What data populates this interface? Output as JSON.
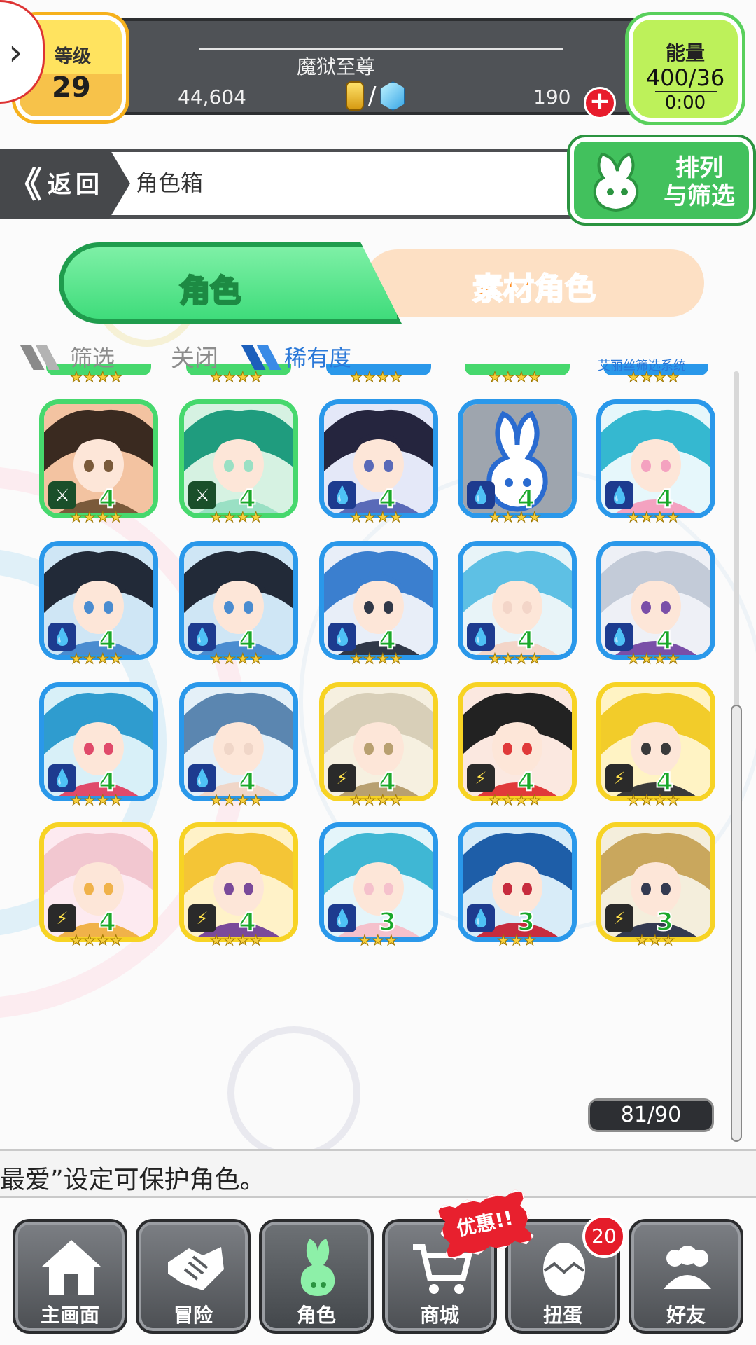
{
  "status": {
    "level_label": "等级",
    "level": "29",
    "rank_title": "魔狱至尊",
    "gold": "44,604",
    "currency_separator": "/",
    "gems": "190",
    "add_symbol": "+",
    "energy_label": "能量",
    "energy": "400/36",
    "energy_timer": "0:00"
  },
  "header": {
    "back_chevron": "《",
    "back_label": "返回",
    "title": "角色箱",
    "sort_filter_label_line1": "排列",
    "sort_filter_label_line2": "与筛选"
  },
  "tabs": [
    {
      "label": "角色",
      "active": true
    },
    {
      "label": "素材角色",
      "active": false
    }
  ],
  "filter": {
    "filter_label": "筛选",
    "close_label": "关闭",
    "rarity_label": "稀有度",
    "system_label": "艾丽丝筛选系统"
  },
  "grid": {
    "partial_row_stars": [
      "★★★★",
      "★★★★",
      "★★★★",
      "★★★★",
      "★★★★"
    ],
    "characters": [
      {
        "element": "wood",
        "element_icon": "leaf-icon",
        "level": "4",
        "stars": "★★★★"
      },
      {
        "element": "wood",
        "element_icon": "leaf-icon",
        "level": "4",
        "stars": "★★★★"
      },
      {
        "element": "water",
        "element_icon": "water-drop-icon",
        "level": "4",
        "stars": "★★★★"
      },
      {
        "element": "water",
        "element_icon": "water-drop-icon",
        "level": "4",
        "stars": "★★★★",
        "placeholder": true
      },
      {
        "element": "water",
        "element_icon": "water-drop-icon",
        "level": "4",
        "stars": "★★★★"
      },
      {
        "element": "water",
        "element_icon": "water-drop-icon",
        "level": "4",
        "stars": "★★★★"
      },
      {
        "element": "water",
        "element_icon": "water-drop-icon",
        "level": "4",
        "stars": "★★★★"
      },
      {
        "element": "water",
        "element_icon": "water-drop-icon",
        "level": "4",
        "stars": "★★★★"
      },
      {
        "element": "water",
        "element_icon": "water-drop-icon",
        "level": "4",
        "stars": "★★★★"
      },
      {
        "element": "water",
        "element_icon": "water-drop-icon",
        "level": "4",
        "stars": "★★★★"
      },
      {
        "element": "water",
        "element_icon": "water-drop-icon",
        "level": "4",
        "stars": "★★★★"
      },
      {
        "element": "water",
        "element_icon": "water-drop-icon",
        "level": "4",
        "stars": "★★★★"
      },
      {
        "element": "thunder",
        "element_icon": "lightning-icon",
        "level": "4",
        "stars": "★★★★"
      },
      {
        "element": "thunder",
        "element_icon": "lightning-icon",
        "level": "4",
        "stars": "★★★★"
      },
      {
        "element": "thunder",
        "element_icon": "lightning-icon",
        "level": "4",
        "stars": "★★★★"
      },
      {
        "element": "thunder",
        "element_icon": "lightning-icon",
        "level": "4",
        "stars": "★★★★"
      },
      {
        "element": "thunder",
        "element_icon": "lightning-icon",
        "level": "4",
        "stars": "★★★★"
      },
      {
        "element": "water",
        "element_icon": "water-drop-icon",
        "level": "3",
        "stars": "★★★"
      },
      {
        "element": "water",
        "element_icon": "water-drop-icon",
        "level": "3",
        "stars": "★★★"
      },
      {
        "element": "thunder",
        "element_icon": "lightning-icon",
        "level": "3",
        "stars": "★★★"
      }
    ]
  },
  "box_counter": "81/90",
  "tip_text": "最爱”设定可保护角色。",
  "bottom_nav": [
    {
      "label": "主画面",
      "icon": "home-icon"
    },
    {
      "label": "冒险",
      "icon": "handshake-icon"
    },
    {
      "label": "角色",
      "icon": "rabbit-icon",
      "active": true
    },
    {
      "label": "商城",
      "icon": "cart-icon"
    },
    {
      "label": "扭蛋",
      "icon": "egg-icon"
    },
    {
      "label": "好友",
      "icon": "friends-icon"
    }
  ],
  "promo_badge": "优惠!!",
  "gacha_count": "20",
  "colors": {
    "wood": "#46d86d",
    "water": "#2a98ea",
    "thunder": "#f7d324",
    "accent_green": "#42c15d",
    "accent_orange": "#ff8a1c"
  }
}
